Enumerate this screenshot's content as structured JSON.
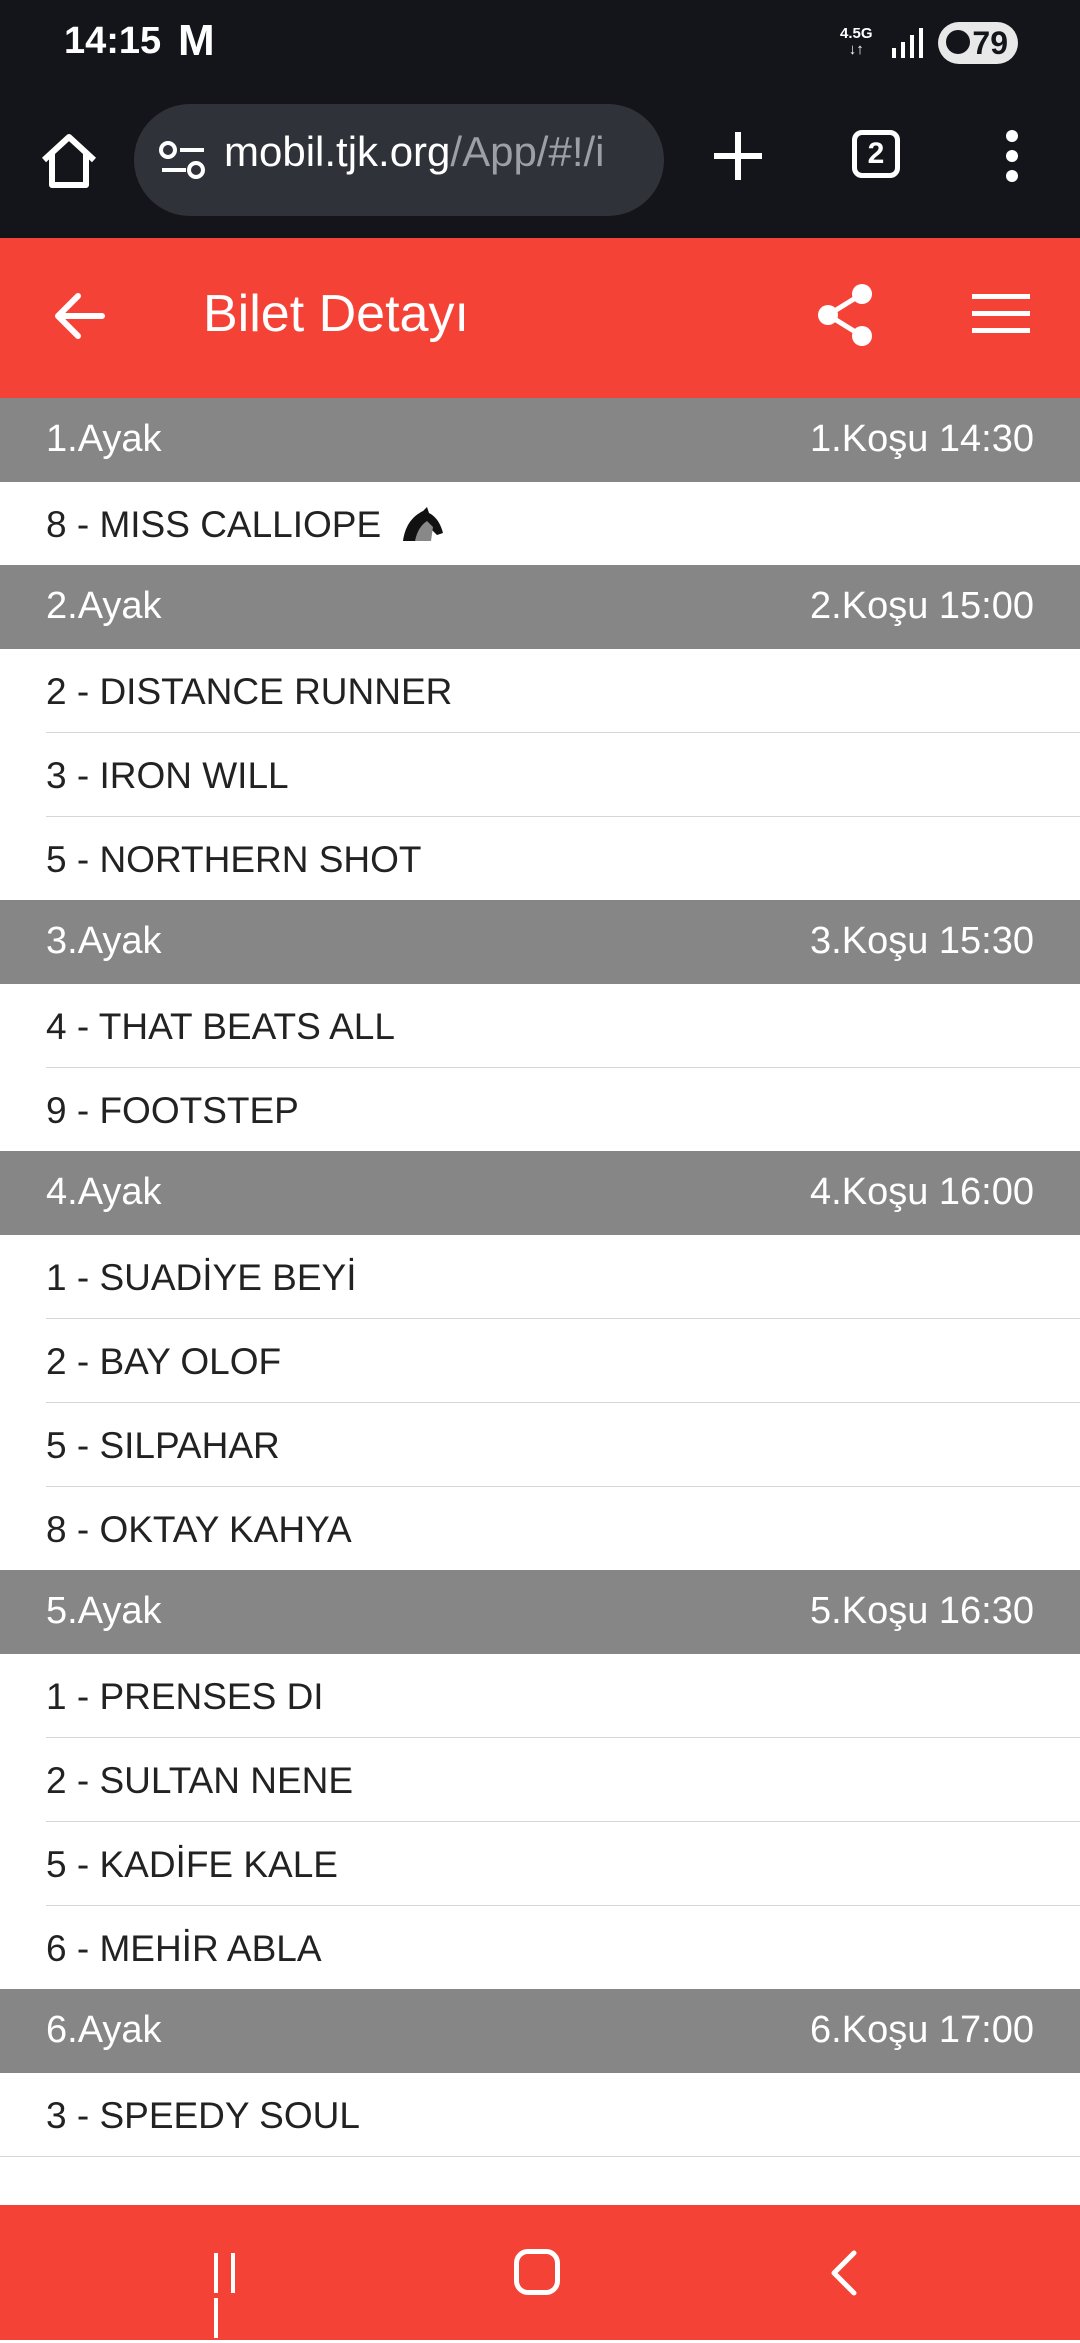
{
  "status_bar": {
    "time": "14:15",
    "carrier_icon_letter": "M",
    "network": "4.5G",
    "battery": "79"
  },
  "browser": {
    "url_host": "mobil.tjk.org",
    "url_path": "/App/#!/i",
    "tab_count": "2"
  },
  "header": {
    "title": "Bilet Detayı"
  },
  "legs": [
    {
      "name": "1.Ayak",
      "race": "1.Koşu 14:30",
      "horses": [
        "8 - MISS CALLIOPE"
      ]
    },
    {
      "name": "2.Ayak",
      "race": "2.Koşu 15:00",
      "horses": [
        "2 - DISTANCE RUNNER",
        "3 - IRON WILL",
        "5 - NORTHERN SHOT"
      ]
    },
    {
      "name": "3.Ayak",
      "race": "3.Koşu 15:30",
      "horses": [
        "4 - THAT BEATS ALL",
        "9 - FOOTSTEP"
      ]
    },
    {
      "name": "4.Ayak",
      "race": "4.Koşu 16:00",
      "horses": [
        "1 - SUADİYE BEYİ",
        "2 - BAY OLOF",
        "5 - SILPAHAR",
        "8 - OKTAY KAHYA"
      ]
    },
    {
      "name": "5.Ayak",
      "race": "5.Koşu 16:30",
      "horses": [
        "1 - PRENSES DI",
        "2 - SULTAN NENE",
        "5 - KADİFE KALE",
        "6 - MEHİR ABLA"
      ]
    },
    {
      "name": "6.Ayak",
      "race": "6.Koşu 17:00",
      "horses": [
        "3 - SPEEDY SOUL"
      ]
    }
  ],
  "icons": {
    "back": "arrow-left-icon",
    "share": "share-icon",
    "menu": "hamburger-menu-icon",
    "horse": "horse-head-icon"
  },
  "colors": {
    "accent": "#f44336",
    "leg_header": "#868686",
    "browser_bg": "#14151a"
  }
}
